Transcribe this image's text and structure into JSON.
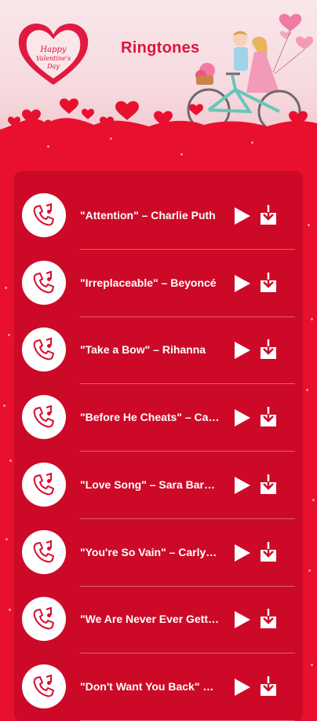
{
  "header": {
    "title": "Ringtones"
  },
  "ringtones": [
    {
      "title": "\"Attention\" – Charlie Puth"
    },
    {
      "title": "\"Irreplaceable\" – Beyoncé"
    },
    {
      "title": "\"Take a Bow\" – Rihanna"
    },
    {
      "title": "\"Before He Cheats\" – Carrie Underwood"
    },
    {
      "title": "\"Love Song\" – Sara Bareilles"
    },
    {
      "title": "\"You're So Vain\" – Carly Simon"
    },
    {
      "title": "\"We Are Never Ever Getting Back Together\""
    },
    {
      "title": "\"Don't Want You Back\" – Backstreet Boys"
    }
  ],
  "colors": {
    "accent": "#e8102e",
    "panel": "#cc0a27",
    "title": "#e0143a"
  },
  "icons": {
    "ringtone": "phone-music-icon",
    "play": "play-icon",
    "download": "download-icon"
  }
}
